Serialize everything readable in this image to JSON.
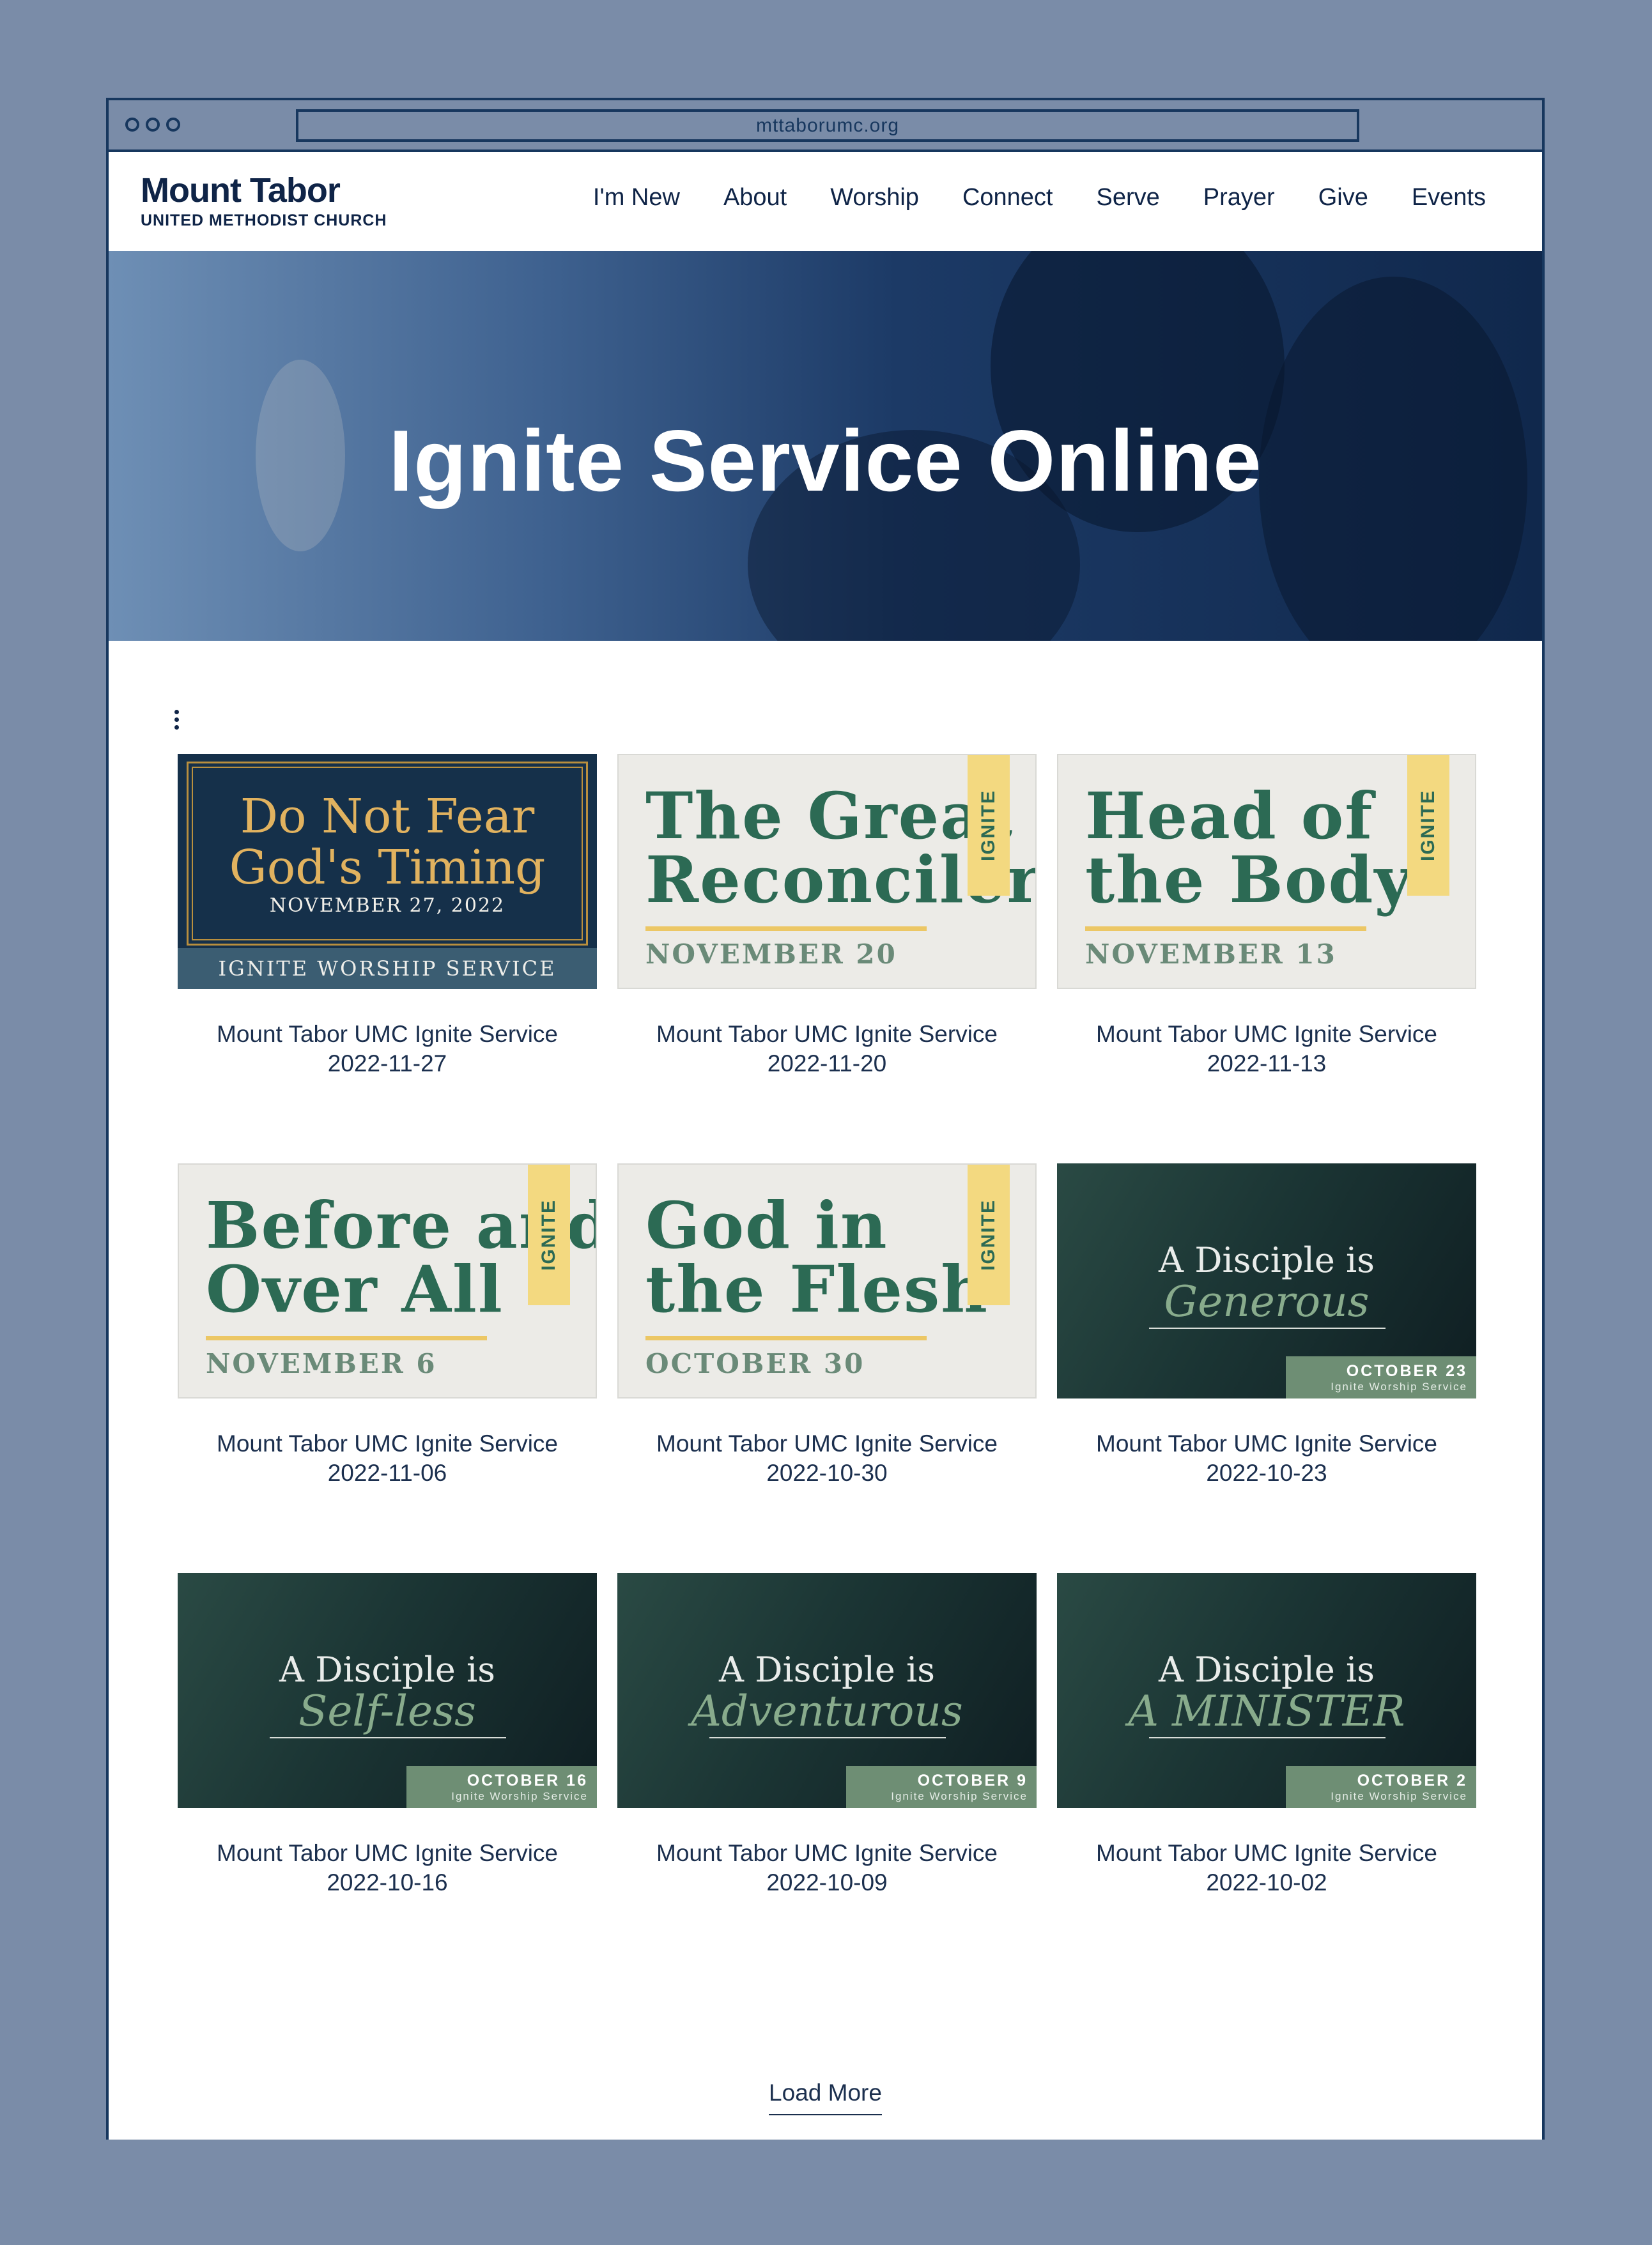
{
  "browser": {
    "url": "mttaborumc.org"
  },
  "site": {
    "logo_main": "Mount Tabor",
    "logo_sub": "UNITED METHODIST CHURCH",
    "nav": [
      "I'm New",
      "About",
      "Worship",
      "Connect",
      "Serve",
      "Prayer",
      "Give",
      "Events"
    ]
  },
  "hero": {
    "title": "Ignite Service Online"
  },
  "videos": [
    {
      "thumb_title": "Do Not Fear\nGod's Timing",
      "thumb_date": "NOVEMBER 27, 2022",
      "thumb_band": "IGNITE WORSHIP SERVICE",
      "title": "Mount Tabor UMC Ignite Service",
      "date": "2022-11-27"
    },
    {
      "thumb_title": "The Great\nReconciler",
      "thumb_date": "NOVEMBER 20",
      "thumb_tag": "IGNITE",
      "title": "Mount Tabor UMC Ignite Service",
      "date": "2022-11-20"
    },
    {
      "thumb_title": "Head of\nthe Body",
      "thumb_date": "NOVEMBER 13",
      "thumb_tag": "IGNITE",
      "title": "Mount Tabor UMC Ignite Service",
      "date": "2022-11-13"
    },
    {
      "thumb_title": "Before and\nOver All",
      "thumb_date": "NOVEMBER 6",
      "thumb_tag": "IGNITE",
      "title": "Mount Tabor UMC Ignite Service",
      "date": "2022-11-06"
    },
    {
      "thumb_title": "God in\nthe Flesh",
      "thumb_date": "OCTOBER 30",
      "thumb_tag": "IGNITE",
      "title": "Mount Tabor UMC Ignite Service",
      "date": "2022-10-30"
    },
    {
      "thumb_line1": "A Disciple is",
      "thumb_line2": "Generous",
      "thumb_date": "OCTOBER 23",
      "thumb_sub": "Ignite Worship Service",
      "title": "Mount Tabor UMC Ignite Service",
      "date": "2022-10-23"
    },
    {
      "thumb_line1": "A Disciple is",
      "thumb_line2": "Self-less",
      "thumb_date": "OCTOBER 16",
      "thumb_sub": "Ignite Worship Service",
      "title": "Mount Tabor UMC Ignite Service",
      "date": "2022-10-16"
    },
    {
      "thumb_line1": "A Disciple is",
      "thumb_line2": "Adventurous",
      "thumb_date": "OCTOBER 9",
      "thumb_sub": "Ignite Worship Service",
      "title": "Mount Tabor UMC Ignite Service",
      "date": "2022-10-09"
    },
    {
      "thumb_line1": "A Disciple is",
      "thumb_line2": "A MINISTER",
      "thumb_date": "OCTOBER 2",
      "thumb_sub": "Ignite Worship Service",
      "title": "Mount Tabor UMC Ignite Service",
      "date": "2022-10-02"
    }
  ],
  "load_more": "Load More"
}
